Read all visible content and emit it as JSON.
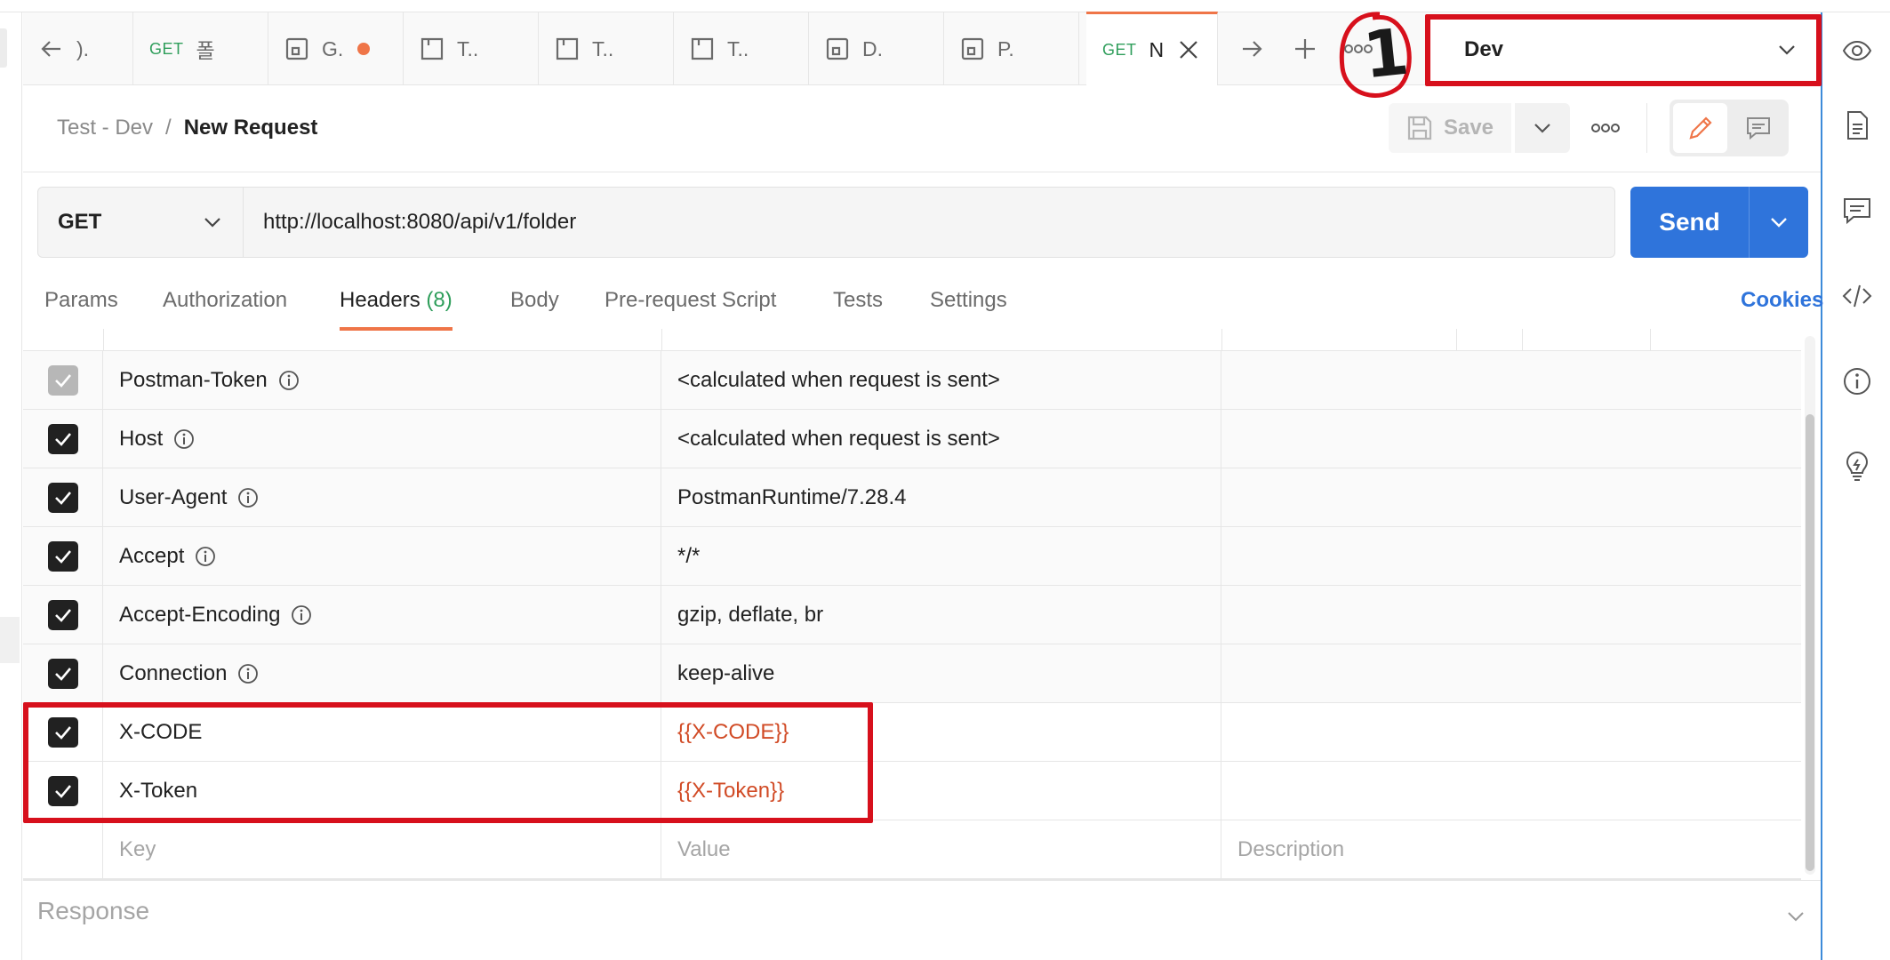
{
  "tabs": [
    {
      "label": ").",
      "icon": "back-arrow-icon"
    },
    {
      "method": "GET",
      "label": "폴",
      "icon": null
    },
    {
      "label": "G.",
      "icon": "collection-icon",
      "unsaved": true
    },
    {
      "label": "T..",
      "icon": "document-icon"
    },
    {
      "label": "T..",
      "icon": "document-icon"
    },
    {
      "label": "T..",
      "icon": "document-icon"
    },
    {
      "label": "D.",
      "icon": "collection-icon"
    },
    {
      "label": "P.",
      "icon": "collection-icon"
    },
    {
      "method": "GET",
      "label": "N",
      "icon": null,
      "active": true
    }
  ],
  "environment": {
    "selected": "Dev"
  },
  "annotation": {
    "circle_text": "1"
  },
  "breadcrumb": {
    "parent": "Test - Dev",
    "separator": "/",
    "current": "New Request"
  },
  "toolbar": {
    "save_label": "Save"
  },
  "request": {
    "method": "GET",
    "url": "http://localhost:8080/api/v1/folder",
    "send_label": "Send"
  },
  "request_tabs": {
    "params": "Params",
    "authorization": "Authorization",
    "headers": "Headers",
    "headers_count": "(8)",
    "body": "Body",
    "pre_request": "Pre-request Script",
    "tests": "Tests",
    "settings": "Settings",
    "cookies": "Cookies"
  },
  "headers": [
    {
      "key": "Postman-Token",
      "value": "<calculated when request is sent>",
      "checked": true,
      "disabled": true,
      "info": true
    },
    {
      "key": "Host",
      "value": "<calculated when request is sent>",
      "checked": true,
      "info": true
    },
    {
      "key": "User-Agent",
      "value": "PostmanRuntime/7.28.4",
      "checked": true,
      "info": true
    },
    {
      "key": "Accept",
      "value": "*/*",
      "checked": true,
      "info": true
    },
    {
      "key": "Accept-Encoding",
      "value": "gzip, deflate, br",
      "checked": true,
      "info": true
    },
    {
      "key": "Connection",
      "value": "keep-alive",
      "checked": true,
      "info": true
    },
    {
      "key": "X-CODE",
      "value": "{{X-CODE}}",
      "checked": true,
      "variable": true
    },
    {
      "key": "X-Token",
      "value": "{{X-Token}}",
      "checked": true,
      "variable": true
    }
  ],
  "new_row": {
    "key_placeholder": "Key",
    "value_placeholder": "Value",
    "description_placeholder": "Description"
  },
  "response": {
    "label": "Response"
  },
  "colors": {
    "accent": "#ef7548",
    "primary": "#2f74db",
    "variable": "#d14b26",
    "annotation": "#d7101c",
    "method_get": "#2f9e5b"
  }
}
